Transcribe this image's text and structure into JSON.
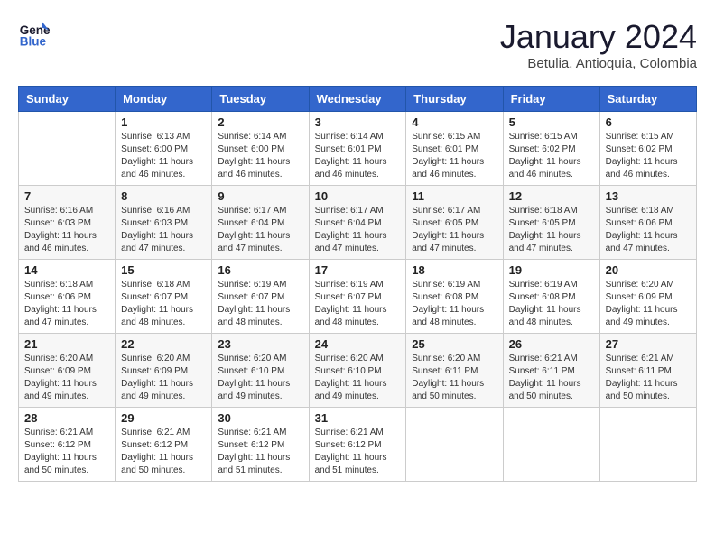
{
  "header": {
    "logo_line1": "General",
    "logo_line2": "Blue",
    "month": "January 2024",
    "location": "Betulia, Antioquia, Colombia"
  },
  "days_of_week": [
    "Sunday",
    "Monday",
    "Tuesday",
    "Wednesday",
    "Thursday",
    "Friday",
    "Saturday"
  ],
  "weeks": [
    [
      {
        "num": "",
        "info": ""
      },
      {
        "num": "1",
        "info": "Sunrise: 6:13 AM\nSunset: 6:00 PM\nDaylight: 11 hours\nand 46 minutes."
      },
      {
        "num": "2",
        "info": "Sunrise: 6:14 AM\nSunset: 6:00 PM\nDaylight: 11 hours\nand 46 minutes."
      },
      {
        "num": "3",
        "info": "Sunrise: 6:14 AM\nSunset: 6:01 PM\nDaylight: 11 hours\nand 46 minutes."
      },
      {
        "num": "4",
        "info": "Sunrise: 6:15 AM\nSunset: 6:01 PM\nDaylight: 11 hours\nand 46 minutes."
      },
      {
        "num": "5",
        "info": "Sunrise: 6:15 AM\nSunset: 6:02 PM\nDaylight: 11 hours\nand 46 minutes."
      },
      {
        "num": "6",
        "info": "Sunrise: 6:15 AM\nSunset: 6:02 PM\nDaylight: 11 hours\nand 46 minutes."
      }
    ],
    [
      {
        "num": "7",
        "info": "Sunrise: 6:16 AM\nSunset: 6:03 PM\nDaylight: 11 hours\nand 46 minutes."
      },
      {
        "num": "8",
        "info": "Sunrise: 6:16 AM\nSunset: 6:03 PM\nDaylight: 11 hours\nand 47 minutes."
      },
      {
        "num": "9",
        "info": "Sunrise: 6:17 AM\nSunset: 6:04 PM\nDaylight: 11 hours\nand 47 minutes."
      },
      {
        "num": "10",
        "info": "Sunrise: 6:17 AM\nSunset: 6:04 PM\nDaylight: 11 hours\nand 47 minutes."
      },
      {
        "num": "11",
        "info": "Sunrise: 6:17 AM\nSunset: 6:05 PM\nDaylight: 11 hours\nand 47 minutes."
      },
      {
        "num": "12",
        "info": "Sunrise: 6:18 AM\nSunset: 6:05 PM\nDaylight: 11 hours\nand 47 minutes."
      },
      {
        "num": "13",
        "info": "Sunrise: 6:18 AM\nSunset: 6:06 PM\nDaylight: 11 hours\nand 47 minutes."
      }
    ],
    [
      {
        "num": "14",
        "info": "Sunrise: 6:18 AM\nSunset: 6:06 PM\nDaylight: 11 hours\nand 47 minutes."
      },
      {
        "num": "15",
        "info": "Sunrise: 6:18 AM\nSunset: 6:07 PM\nDaylight: 11 hours\nand 48 minutes."
      },
      {
        "num": "16",
        "info": "Sunrise: 6:19 AM\nSunset: 6:07 PM\nDaylight: 11 hours\nand 48 minutes."
      },
      {
        "num": "17",
        "info": "Sunrise: 6:19 AM\nSunset: 6:07 PM\nDaylight: 11 hours\nand 48 minutes."
      },
      {
        "num": "18",
        "info": "Sunrise: 6:19 AM\nSunset: 6:08 PM\nDaylight: 11 hours\nand 48 minutes."
      },
      {
        "num": "19",
        "info": "Sunrise: 6:19 AM\nSunset: 6:08 PM\nDaylight: 11 hours\nand 48 minutes."
      },
      {
        "num": "20",
        "info": "Sunrise: 6:20 AM\nSunset: 6:09 PM\nDaylight: 11 hours\nand 49 minutes."
      }
    ],
    [
      {
        "num": "21",
        "info": "Sunrise: 6:20 AM\nSunset: 6:09 PM\nDaylight: 11 hours\nand 49 minutes."
      },
      {
        "num": "22",
        "info": "Sunrise: 6:20 AM\nSunset: 6:09 PM\nDaylight: 11 hours\nand 49 minutes."
      },
      {
        "num": "23",
        "info": "Sunrise: 6:20 AM\nSunset: 6:10 PM\nDaylight: 11 hours\nand 49 minutes."
      },
      {
        "num": "24",
        "info": "Sunrise: 6:20 AM\nSunset: 6:10 PM\nDaylight: 11 hours\nand 49 minutes."
      },
      {
        "num": "25",
        "info": "Sunrise: 6:20 AM\nSunset: 6:11 PM\nDaylight: 11 hours\nand 50 minutes."
      },
      {
        "num": "26",
        "info": "Sunrise: 6:21 AM\nSunset: 6:11 PM\nDaylight: 11 hours\nand 50 minutes."
      },
      {
        "num": "27",
        "info": "Sunrise: 6:21 AM\nSunset: 6:11 PM\nDaylight: 11 hours\nand 50 minutes."
      }
    ],
    [
      {
        "num": "28",
        "info": "Sunrise: 6:21 AM\nSunset: 6:12 PM\nDaylight: 11 hours\nand 50 minutes."
      },
      {
        "num": "29",
        "info": "Sunrise: 6:21 AM\nSunset: 6:12 PM\nDaylight: 11 hours\nand 50 minutes."
      },
      {
        "num": "30",
        "info": "Sunrise: 6:21 AM\nSunset: 6:12 PM\nDaylight: 11 hours\nand 51 minutes."
      },
      {
        "num": "31",
        "info": "Sunrise: 6:21 AM\nSunset: 6:12 PM\nDaylight: 11 hours\nand 51 minutes."
      },
      {
        "num": "",
        "info": ""
      },
      {
        "num": "",
        "info": ""
      },
      {
        "num": "",
        "info": ""
      }
    ]
  ]
}
